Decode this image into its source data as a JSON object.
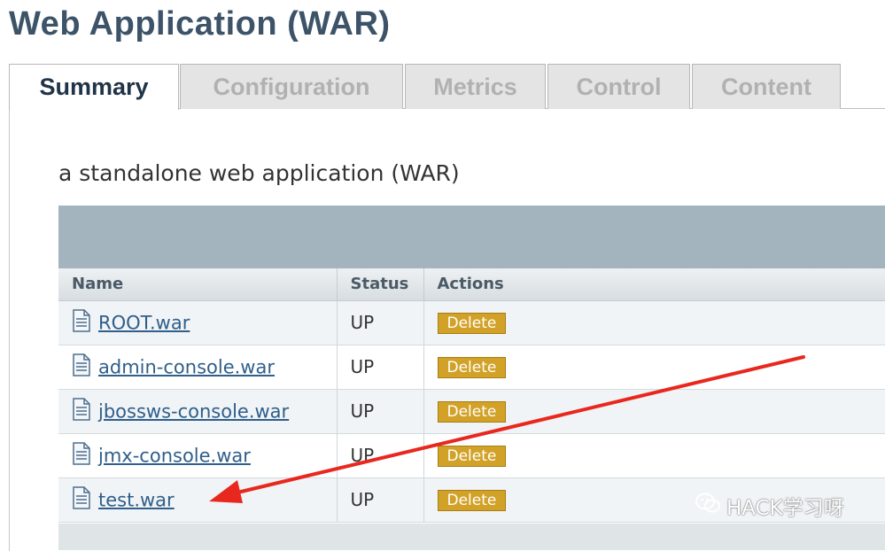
{
  "page": {
    "title": "Web Application (WAR)",
    "subtitle": "a standalone web application (WAR)"
  },
  "tabs": [
    {
      "label": "Summary",
      "active": true
    },
    {
      "label": "Configuration",
      "active": false
    },
    {
      "label": "Metrics",
      "active": false
    },
    {
      "label": "Control",
      "active": false
    },
    {
      "label": "Content",
      "active": false
    }
  ],
  "table": {
    "columns": [
      "Name",
      "Status",
      "Actions"
    ],
    "rows": [
      {
        "name": "ROOT.war",
        "status": "UP",
        "action": "Delete"
      },
      {
        "name": "admin-console.war",
        "status": "UP",
        "action": "Delete"
      },
      {
        "name": "jbossws-console.war",
        "status": "UP",
        "action": "Delete"
      },
      {
        "name": "jmx-console.war",
        "status": "UP",
        "action": "Delete"
      },
      {
        "name": "test.war",
        "status": "UP",
        "action": "Delete"
      }
    ]
  },
  "watermark": {
    "text": "HACK学习呀"
  },
  "colors": {
    "title": "#3c5368",
    "accent_button": "#d2a127",
    "link": "#2f5f8a",
    "annotation_arrow": "#e8281e"
  }
}
